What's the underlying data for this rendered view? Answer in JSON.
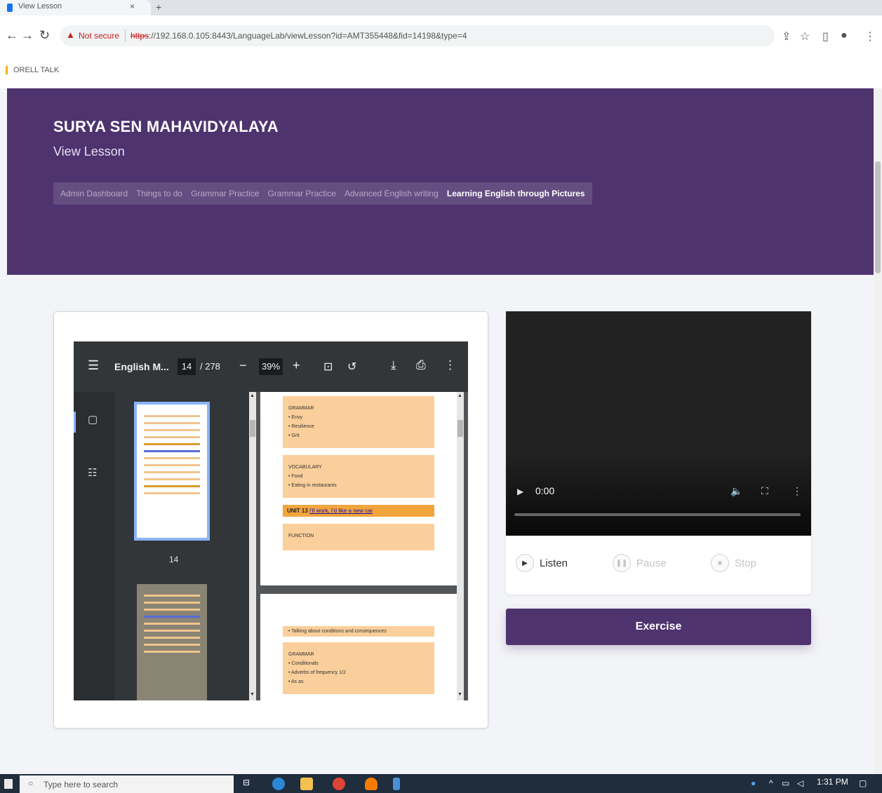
{
  "browser": {
    "tab_title": "View Lesson",
    "tab_close": "×",
    "new_tab": "+",
    "not_secure_label": "Not secure",
    "url_protocol": "https",
    "url_rest": "://192.168.0.105:8443/LanguageLab/viewLesson?id=AMT355448&fid=14198&type=4",
    "bookmark": "ORELL TALK"
  },
  "header": {
    "institute": "SURYA SEN MAHAVIDYALAYA",
    "page_title": "View Lesson",
    "breadcrumbs": [
      "Admin Dashboard",
      "Things to do",
      "Grammar Practice",
      "Grammar Practice",
      "Advanced English writing",
      "Learning English through Pictures"
    ]
  },
  "pdf_viewer": {
    "file_title": "English M...",
    "current_page": "14",
    "total_pages": "/ 278",
    "zoom": "39%",
    "thumbnail_label": "14",
    "page1_blocks": [
      {
        "lines": [
          "GRAMMAR",
          "• Envy",
          "• Resilience",
          "• Grit"
        ]
      },
      {
        "lines": [
          "VOCABULARY",
          "• Food",
          "• Eating in restaurants"
        ]
      }
    ],
    "unit_label": "UNIT 13",
    "unit_link": "I'll work, I'd like a new car",
    "function_label": "FUNCTION",
    "page2_top": "• Talking about conditions and consequences",
    "page2_lines": [
      "GRAMMAR",
      "• Conditionals",
      "• Adverbs of frequency 1/2",
      "• As as"
    ]
  },
  "media": {
    "video_time": "0:00",
    "listen_label": "Listen",
    "pause_label": "Pause",
    "stop_label": "Stop"
  },
  "exercise_label": "Exercise",
  "taskbar": {
    "search_placeholder": "Type here to search",
    "time": "1:31 PM"
  }
}
